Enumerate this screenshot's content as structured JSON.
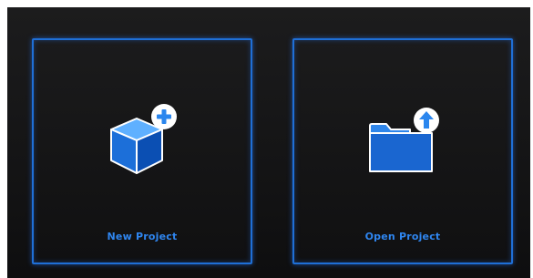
{
  "cards": [
    {
      "label": "New Project",
      "icon": "cube-plus-icon"
    },
    {
      "label": "Open Project",
      "icon": "folder-upload-icon"
    }
  ],
  "colors": {
    "accent": "#1f6fd6",
    "label": "#2f86f0",
    "background": "#151516"
  }
}
